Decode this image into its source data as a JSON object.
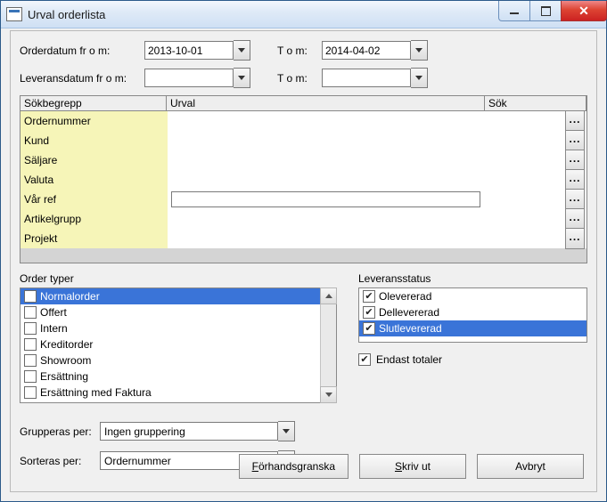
{
  "window": {
    "title": "Urval orderlista"
  },
  "dates": {
    "order_from_label": "Orderdatum fr o m:",
    "order_from": "2013-10-01",
    "order_to_label": "T o m:",
    "order_to": "2014-04-02",
    "delivery_from_label": "Leveransdatum fr o m:",
    "delivery_from": "",
    "delivery_to_label": "T o m:",
    "delivery_to": ""
  },
  "grid": {
    "headers": {
      "label": "Sökbegrepp",
      "urval": "Urval",
      "sok": "Sök"
    },
    "rows": [
      {
        "label": "Ordernummer"
      },
      {
        "label": "Kund"
      },
      {
        "label": "Säljare"
      },
      {
        "label": "Valuta"
      },
      {
        "label": "Vår ref",
        "has_input": true
      },
      {
        "label": "Artikelgrupp"
      },
      {
        "label": "Projekt"
      }
    ],
    "ellipsis": "..."
  },
  "order_types": {
    "label": "Order typer",
    "items": [
      {
        "label": "Normalorder",
        "checked": false,
        "selected": true
      },
      {
        "label": "Offert",
        "checked": false
      },
      {
        "label": "Intern",
        "checked": false
      },
      {
        "label": "Kreditorder",
        "checked": false
      },
      {
        "label": "Showroom",
        "checked": false
      },
      {
        "label": "Ersättning",
        "checked": false
      },
      {
        "label": "Ersättning med Faktura",
        "checked": false
      }
    ]
  },
  "delivery_status": {
    "label": "Leveransstatus",
    "items": [
      {
        "label": "Olevererad",
        "checked": true
      },
      {
        "label": "Dellevererad",
        "checked": true
      },
      {
        "label": "Slutlevererad",
        "checked": true,
        "selected": true
      }
    ]
  },
  "only_totals": {
    "label": "Endast totaler",
    "checked": true
  },
  "group_by": {
    "label": "Grupperas per:",
    "value": "Ingen gruppering"
  },
  "sort_by": {
    "label": "Sorteras per:",
    "value": "Ordernummer"
  },
  "actions": {
    "preview": "Förhandsgranska",
    "print": "Skriv ut",
    "cancel": "Avbryt"
  }
}
